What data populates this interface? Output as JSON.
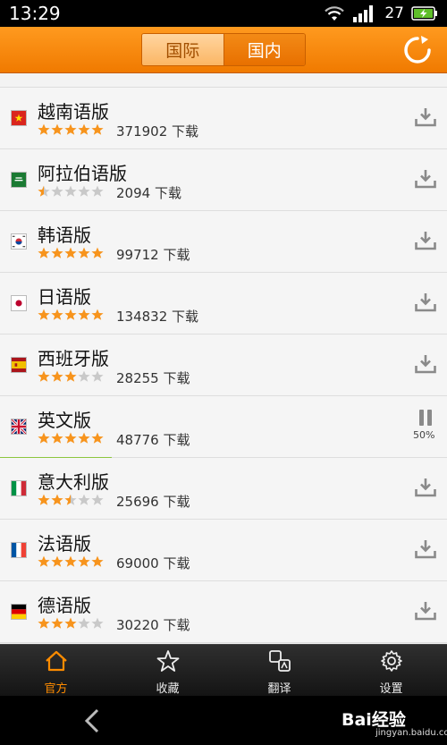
{
  "status_bar": {
    "time": "13:29",
    "battery_level": "27"
  },
  "header": {
    "tabs": [
      {
        "label": "国际",
        "active": false
      },
      {
        "label": "国内",
        "active": true
      }
    ],
    "refresh_icon": "refresh-icon",
    "accent_color": "#f28a0e"
  },
  "list": {
    "download_suffix": "下载",
    "items": [
      {
        "name": "越南语版",
        "flag": "vietnam-flag",
        "rating": 5,
        "downloads": "371902 下载",
        "state": "download"
      },
      {
        "name": "阿拉伯语版",
        "flag": "saudi-flag",
        "rating": 0.5,
        "downloads": "2094 下载",
        "state": "download"
      },
      {
        "name": "韩语版",
        "flag": "korea-flag",
        "rating": 5,
        "downloads": "99712 下载",
        "state": "download"
      },
      {
        "name": "日语版",
        "flag": "japan-flag",
        "rating": 5,
        "downloads": "134832 下载",
        "state": "download"
      },
      {
        "name": "西班牙版",
        "flag": "spain-flag",
        "rating": 3,
        "downloads": "28255 下载",
        "state": "download"
      },
      {
        "name": "英文版",
        "flag": "uk-flag",
        "rating": 5,
        "downloads": "48776 下载",
        "state": "downloading",
        "progress_label": "50%",
        "progress": 0.5
      },
      {
        "name": "意大利版",
        "flag": "italy-flag",
        "rating": 2.5,
        "downloads": "25696 下载",
        "state": "download"
      },
      {
        "name": "法语版",
        "flag": "france-flag",
        "rating": 5,
        "downloads": "69000 下载",
        "state": "download"
      },
      {
        "name": "德语版",
        "flag": "germany-flag",
        "rating": 3,
        "downloads": "30220 下载",
        "state": "download"
      }
    ]
  },
  "bottom_nav": [
    {
      "label": "官方",
      "icon": "home-icon",
      "active": true
    },
    {
      "label": "收藏",
      "icon": "star-icon",
      "active": false
    },
    {
      "label": "翻译",
      "icon": "translate-icon",
      "active": false
    },
    {
      "label": "设置",
      "icon": "gear-icon",
      "active": false
    }
  ],
  "watermark": {
    "brand": "Bai",
    "brand_cn": "经验",
    "site": "jingyan.baidu.com"
  }
}
